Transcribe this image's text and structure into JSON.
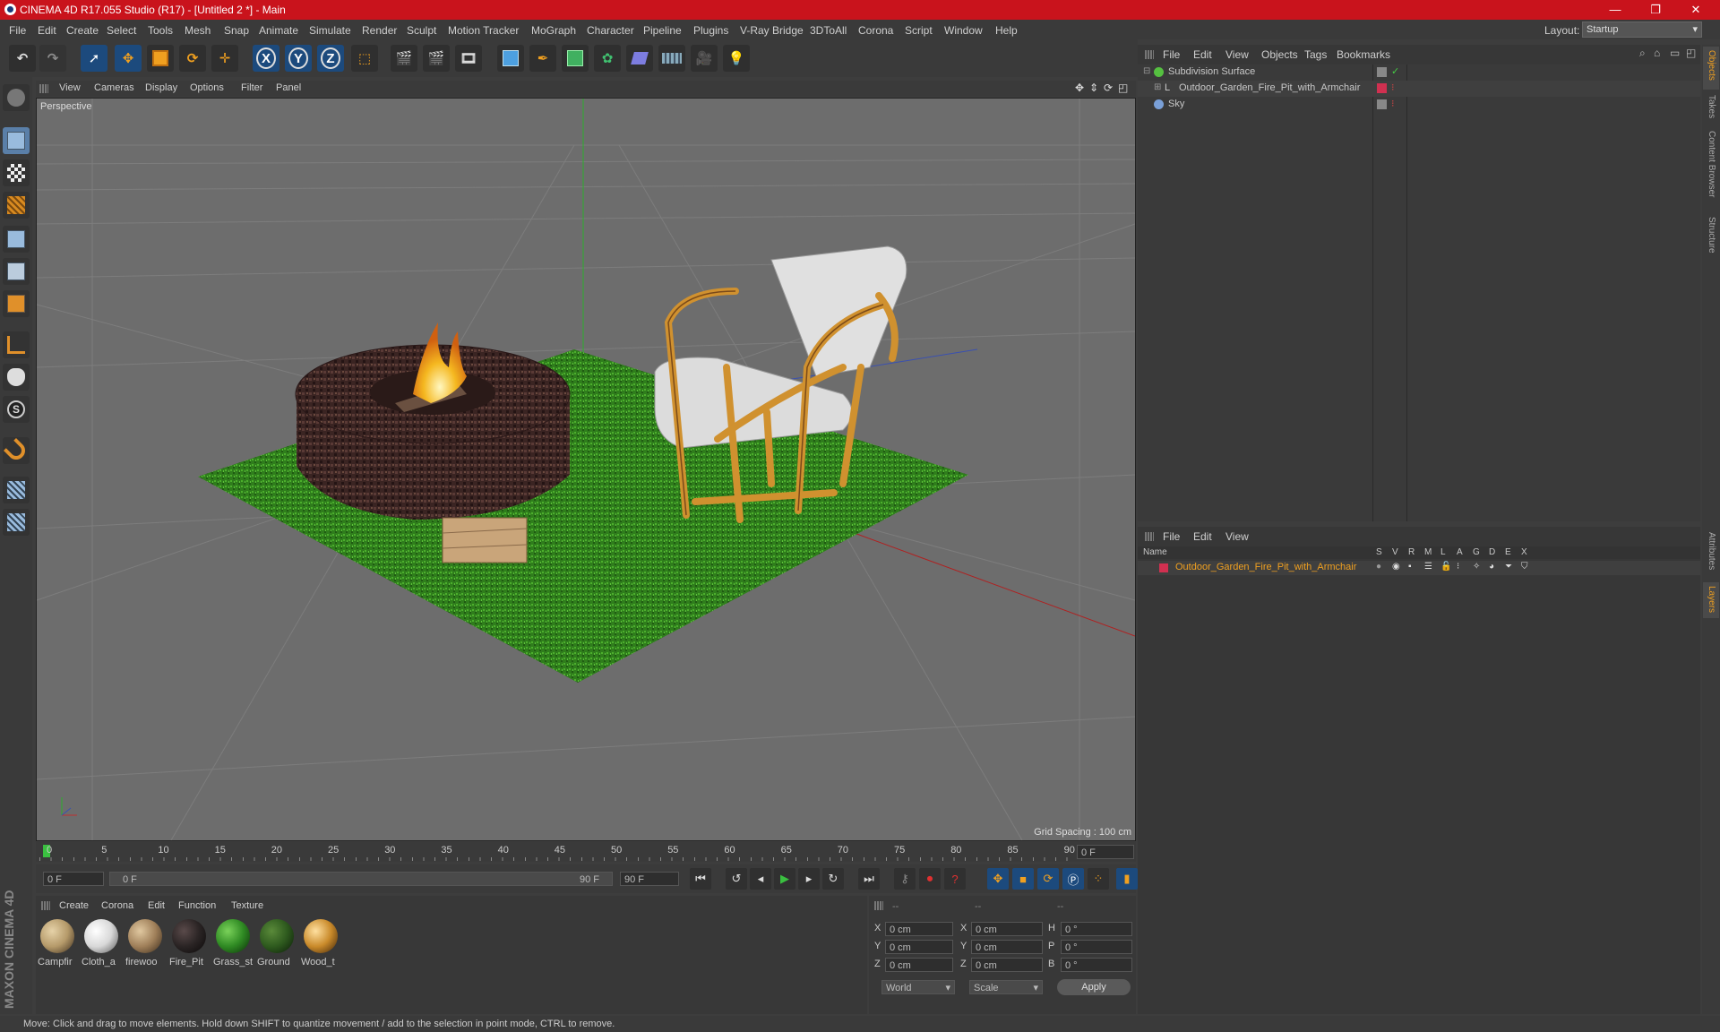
{
  "window": {
    "title": "CINEMA 4D R17.055 Studio (R17) - [Untitled 2 *] - Main",
    "minimize": "—",
    "restore": "❐",
    "close": "✕"
  },
  "menubar": {
    "items": [
      "File",
      "Edit",
      "Create",
      "Select",
      "Tools",
      "Mesh",
      "Snap",
      "Animate",
      "Simulate",
      "Render",
      "Sculpt",
      "Motion Tracker",
      "MoGraph",
      "Character",
      "Pipeline",
      "Plugins",
      "V-Ray Bridge",
      "3DToAll",
      "Corona",
      "Script",
      "Window",
      "Help"
    ],
    "layout_label": "Layout:",
    "layout_value": "Startup"
  },
  "toolbar": {
    "axis_x": "X",
    "axis_y": "Y",
    "axis_z": "Z"
  },
  "viewport": {
    "menu": [
      "View",
      "Cameras",
      "Display",
      "Options",
      "Filter",
      "Panel"
    ],
    "label": "Perspective",
    "grid_spacing": "Grid Spacing : 100 cm"
  },
  "timeline": {
    "ticks": [
      "0",
      "5",
      "10",
      "15",
      "20",
      "25",
      "30",
      "35",
      "40",
      "45",
      "50",
      "55",
      "60",
      "65",
      "70",
      "75",
      "80",
      "85",
      "90"
    ],
    "current_frame": "0 F",
    "start_field": "0 F",
    "range_start": "0 F",
    "range_end": "90 F",
    "end_field": "90 F"
  },
  "materials": {
    "menu": [
      "Create",
      "Corona",
      "Edit",
      "Function",
      "Texture"
    ],
    "items": [
      {
        "label": "Campfir",
        "color": "#b59a6a"
      },
      {
        "label": "Cloth_a",
        "color": "#d8d8d8"
      },
      {
        "label": "firewoo",
        "color": "#a0805a"
      },
      {
        "label": "Fire_Pit",
        "color": "#2a2424"
      },
      {
        "label": "Grass_st",
        "color": "#2f8a23"
      },
      {
        "label": "Ground",
        "color": "#2e5a1e"
      },
      {
        "label": "Wood_t",
        "color": "#c98a2a"
      }
    ]
  },
  "coords": {
    "headers": [
      "--",
      "--",
      "--"
    ],
    "rows": [
      {
        "a": "X",
        "av": "0 cm",
        "b": "X",
        "bv": "0 cm",
        "c": "H",
        "cv": "0 °"
      },
      {
        "a": "Y",
        "av": "0 cm",
        "b": "Y",
        "bv": "0 cm",
        "c": "P",
        "cv": "0 °"
      },
      {
        "a": "Z",
        "av": "0 cm",
        "b": "Z",
        "bv": "0 cm",
        "c": "B",
        "cv": "0 °"
      }
    ],
    "mode": "World",
    "scale": "Scale",
    "apply": "Apply"
  },
  "object_manager": {
    "menu": [
      "File",
      "Edit",
      "View",
      "Objects",
      "Tags",
      "Bookmarks"
    ],
    "objects": [
      {
        "name": "Subdivision Surface",
        "color": "#55c040"
      },
      {
        "name": "Outdoor_Garden_Fire_Pit_with_Armchair",
        "color": "#d0d0d0"
      },
      {
        "name": "Sky",
        "color": "#7aa0d8"
      }
    ]
  },
  "layer_manager": {
    "menu": [
      "File",
      "Edit",
      "View"
    ],
    "columns": [
      "Name",
      "S",
      "V",
      "R",
      "M",
      "L",
      "A",
      "G",
      "D",
      "E",
      "X"
    ],
    "layer_name": "Outdoor_Garden_Fire_Pit_with_Armchair",
    "layer_color": "#d03050"
  },
  "side_tabs": [
    "Objects",
    "Takes",
    "Content Browser",
    "Structure",
    "Attributes",
    "Layers"
  ],
  "status": "Move: Click and drag to move elements. Hold down SHIFT to quantize movement / add to the selection in point mode, CTRL to remove.",
  "brand": "MAXON CINEMA 4D"
}
